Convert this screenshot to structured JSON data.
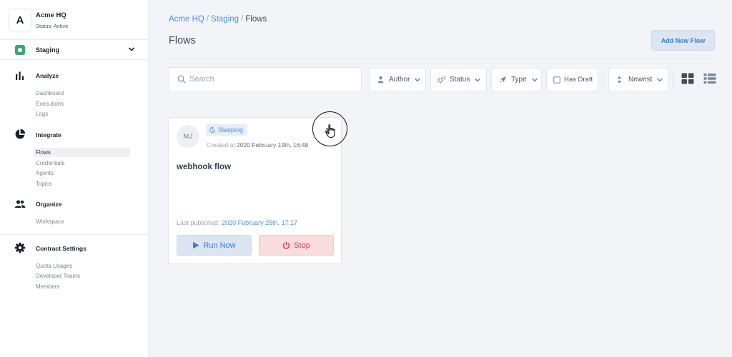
{
  "org": {
    "avatar_letter": "A",
    "name": "Acme HQ",
    "status": "Status: Active"
  },
  "environment": {
    "label": "Staging",
    "accent_color": "#3aa76d"
  },
  "sidebar": {
    "sections": [
      {
        "title": "Analyze",
        "icon": "bar-chart-icon",
        "items": [
          {
            "label": "Dashboard"
          },
          {
            "label": "Executions"
          },
          {
            "label": "Logs"
          }
        ]
      },
      {
        "title": "Integrate",
        "icon": "pie-chart-icon",
        "items": [
          {
            "label": "Flows",
            "active": true
          },
          {
            "label": "Credentials"
          },
          {
            "label": "Agents"
          },
          {
            "label": "Topics"
          }
        ]
      },
      {
        "title": "Organize",
        "icon": "people-icon",
        "items": [
          {
            "label": "Workspace"
          }
        ]
      },
      {
        "title": "Contract Settings",
        "icon": "gear-icon",
        "items": [
          {
            "label": "Quota Usages"
          },
          {
            "label": "Developer Teams"
          },
          {
            "label": "Members"
          }
        ]
      }
    ]
  },
  "breadcrumb": {
    "items": [
      "Acme HQ",
      "Staging",
      "Flows"
    ],
    "separator": "/"
  },
  "page": {
    "title": "Flows",
    "add_button": "Add New Flow"
  },
  "search": {
    "placeholder": "Search",
    "value": ""
  },
  "filters": {
    "author": "Author",
    "status": "Status",
    "type": "Type",
    "has_draft": "Has Draft",
    "has_draft_checked": false,
    "sort": "Newest"
  },
  "view_modes": {
    "selected": "grid",
    "options": [
      "grid-view-icon",
      "list-view-icon"
    ]
  },
  "flows": [
    {
      "author_initials": "MJ",
      "state": "Sleeping",
      "created_label": "Created at",
      "created_at": "2020 February 19th, 16:48",
      "name": "webhook flow",
      "published_label": "Last published:",
      "published_at": "2020 February 25th, 17:17",
      "run_label": "Run Now",
      "stop_label": "Stop"
    }
  ],
  "colors": {
    "primary": "#4a90d9",
    "danger": "#d0454f",
    "background": "#f2f4f7"
  }
}
